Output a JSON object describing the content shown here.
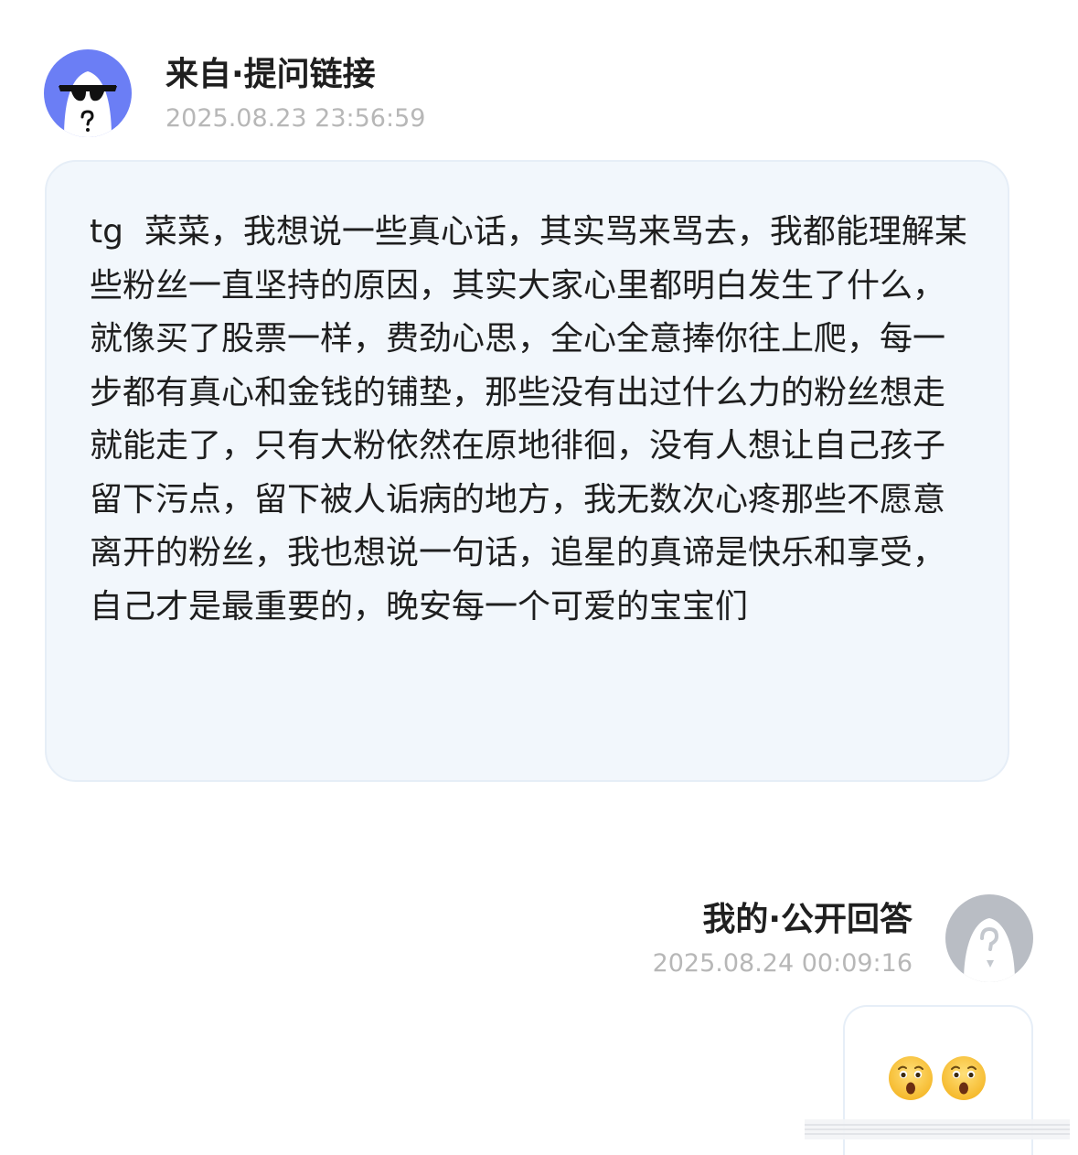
{
  "question": {
    "header_title": "来自·提问链接",
    "timestamp": "2025.08.23 23:56:59",
    "body": "tg  菜菜，我想说一些真心话，其实骂来骂去，我都能理解某些粉丝一直坚持的原因，其实大家心里都明白发生了什么，就像买了股票一样，费劲心思，全心全意捧你往上爬，每一步都有真心和金钱的铺垫，那些没有出过什么力的粉丝想走就能走了，只有大粉依然在原地徘徊，没有人想让自己孩子留下污点，留下被人诟病的地方，我无数次心疼那些不愿意离开的粉丝，我也想说一句话，追星的真谛是快乐和享受，自己才是最重要的，晚安每一个可爱的宝宝们",
    "avatar_icon": "anonymous-sunglasses-avatar-icon",
    "avatar_color": "#6b7ef5"
  },
  "answer": {
    "header_title": "我的·公开回答",
    "timestamp": "2025.08.24 00:09:16",
    "avatar_icon": "anonymous-question-avatar-icon",
    "avatar_color": "#b9bdc4",
    "emojis": [
      "astonished-face-icon",
      "astonished-face-icon"
    ]
  },
  "colors": {
    "question_bubble_bg": "#f2f7fc",
    "timestamp_gray": "#b7b7b7",
    "title_dark": "#1f1f1f"
  }
}
